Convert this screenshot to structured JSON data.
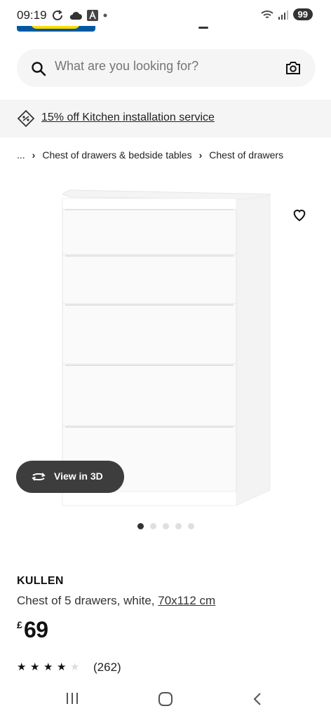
{
  "status_bar": {
    "time": "09:19",
    "battery": "99",
    "left_icons": [
      "sync-icon",
      "cloud-icon",
      "a-badge-icon",
      "dot-icon"
    ],
    "right_icons": [
      "wifi-icon",
      "signal-icon"
    ]
  },
  "search": {
    "placeholder": "What are you looking for?"
  },
  "promo": {
    "text": "15% off Kitchen installation service"
  },
  "breadcrumb": {
    "items": [
      "...",
      "Chest of drawers & bedside tables",
      "Chest of drawers"
    ]
  },
  "gallery": {
    "view3d_label": "View in 3D",
    "image_count": 5,
    "active_index": 0
  },
  "product": {
    "name": "KULLEN",
    "description": "Chest of 5 drawers, white,",
    "size": "70x112 cm",
    "currency": "£",
    "price": "69",
    "rating": 4,
    "rating_max": 5,
    "review_count": "(262)"
  },
  "colors": {
    "accent_dark": "#3d3d3d",
    "ikea_blue": "#0058a3",
    "ikea_yellow": "#ffdb00",
    "surface_grey": "#f5f5f5"
  }
}
